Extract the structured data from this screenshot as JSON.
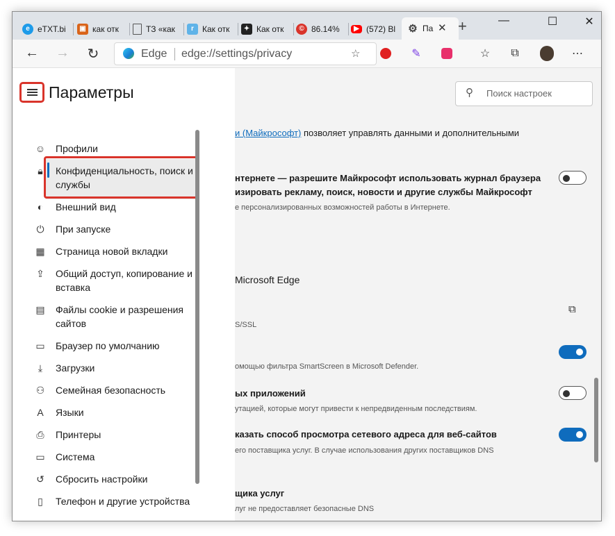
{
  "tabs": [
    {
      "label": "eTXT.bi",
      "icon": "etxt-icon",
      "color": "#1e9be9"
    },
    {
      "label": "как отк",
      "icon": "book-icon",
      "color": "#d9641a"
    },
    {
      "label": "ТЗ «как",
      "icon": "document-icon",
      "color": "#ffffff"
    },
    {
      "label": "Как отк",
      "icon": "telegraph-icon",
      "color": "#5fb3e8"
    },
    {
      "label": "Как отк",
      "icon": "sparkle-icon",
      "color": "#222222"
    },
    {
      "label": "86.14%",
      "icon": "copyright-icon",
      "color": "#d9342b"
    },
    {
      "label": "(572) Bl",
      "icon": "youtube-icon",
      "color": "#ff0000"
    },
    {
      "label": "Па",
      "icon": "gear-icon",
      "color": "#555555"
    }
  ],
  "toolbar": {
    "brand": "Edge",
    "url": "edge://settings/privacy"
  },
  "sidebar": {
    "title": "Параметры",
    "items": [
      {
        "label": "Профили",
        "icon": "profile-icon"
      },
      {
        "label": "Конфиденциальность, поиск и службы",
        "icon": "lock-icon"
      },
      {
        "label": "Внешний вид",
        "icon": "palette-icon"
      },
      {
        "label": "При запуске",
        "icon": "power-icon"
      },
      {
        "label": "Страница новой вкладки",
        "icon": "new-tab-page-icon"
      },
      {
        "label": "Общий доступ, копирование и вставка",
        "icon": "share-icon"
      },
      {
        "label": "Файлы cookie и разрешения сайтов",
        "icon": "cookie-icon"
      },
      {
        "label": "Браузер по умолчанию",
        "icon": "default-browser-icon"
      },
      {
        "label": "Загрузки",
        "icon": "download-icon"
      },
      {
        "label": "Семейная безопасность",
        "icon": "family-icon"
      },
      {
        "label": "Языки",
        "icon": "language-icon"
      },
      {
        "label": "Принтеры",
        "icon": "printer-icon"
      },
      {
        "label": "Система",
        "icon": "system-icon"
      },
      {
        "label": "Сбросить настройки",
        "icon": "reset-icon"
      },
      {
        "label": "Телефон и другие устройства",
        "icon": "phone-icon"
      }
    ]
  },
  "search": {
    "placeholder": "Поиск настроек"
  },
  "content": {
    "line1_link": "и (Майкрософт)",
    "line1_rest": " позволяет управлять данными и дополнительными",
    "s1_title_a": "нтернете — разрешите Майкрософт использовать журнал браузера",
    "s1_title_b": "изировать рекламу, поиск, новости и другие службы Майкрософт",
    "s1_desc": "е персонализированных возможностей работы в Интернете.",
    "s2_heading": "Microsoft Edge",
    "s3_desc": "S/SSL",
    "s4_desc": "омощью фильтра SmartScreen в Microsoft Defender.",
    "s5_title": "ых приложений",
    "s5_desc": "утацией, которые могут привести к непредвиденным последствиям.",
    "s6_title": "казать способ просмотра сетевого адреса для веб-сайтов",
    "s6_desc": "его поставщика услуг. В случае использования других поставщиков DNS",
    "s7_title": "щика услуг",
    "s7_desc": "луг не предоставляет безопасные DNS"
  },
  "toggles": {
    "personalize": false,
    "smartscreen": true,
    "pua": false,
    "secure_dns": true
  },
  "colors": {
    "accent": "#0f6cbd",
    "highlight": "#d9342b"
  }
}
